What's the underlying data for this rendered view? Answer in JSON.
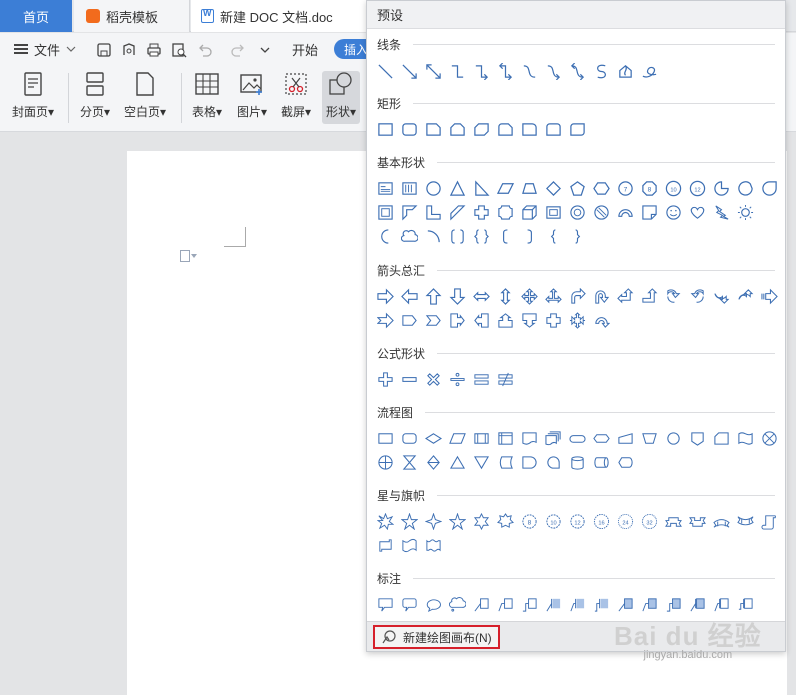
{
  "tabs": {
    "home": "首页",
    "daoke": "稻壳模板",
    "doc": "新建 DOC 文档.doc"
  },
  "menubar": {
    "file": "文件",
    "start": "开始",
    "insert": "插入"
  },
  "ribbon": {
    "cover": "封面页",
    "pagebreak": "分页",
    "blankpage": "空白页",
    "table": "表格",
    "picture": "图片",
    "screenshot": "截屏",
    "shape": "形状"
  },
  "panel": {
    "title": "预设",
    "sections": {
      "lines": "线条",
      "rect": "矩形",
      "basic": "基本形状",
      "arrows": "箭头总汇",
      "formula": "公式形状",
      "flow": "流程图",
      "stars": "星与旗帜",
      "callout": "标注"
    },
    "new_canvas": "新建绘图画布(N)"
  },
  "watermark": {
    "brand": "Bai du 经验",
    "url": "jingyan.baidu.com"
  },
  "colors": {
    "accent": "#3c7ed6",
    "shape_stroke": "#3d6fb3",
    "highlight": "#d6202b"
  }
}
